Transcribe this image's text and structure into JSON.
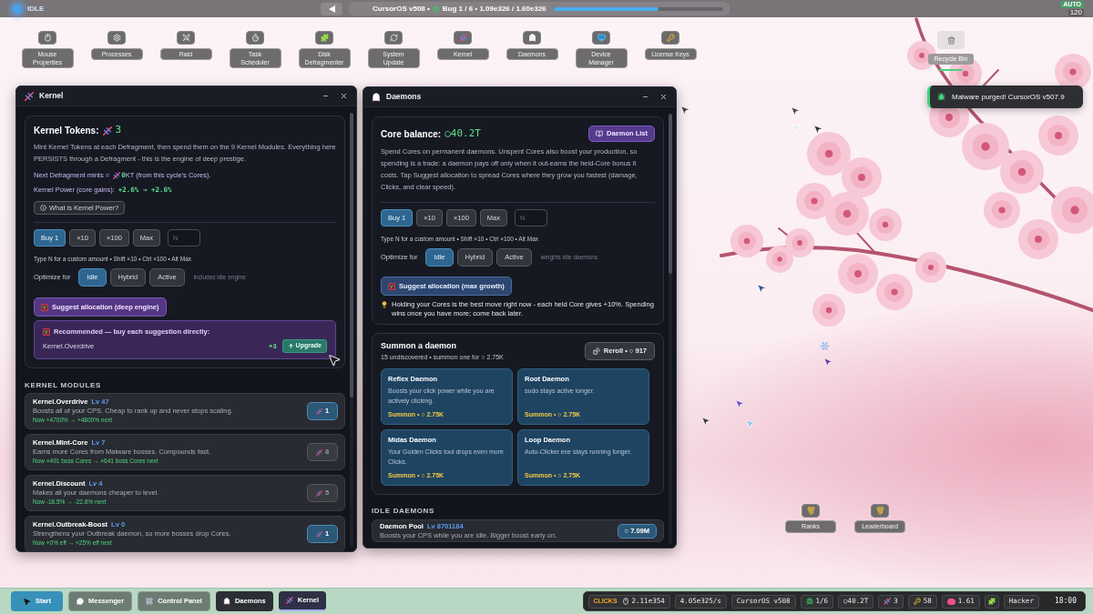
{
  "top_bar": {
    "status": "IDLE",
    "title": "CursorOS v508 •",
    "bug": "Bug 1 / 6 • 1.09e326 / 1.60e326",
    "progress": {
      "level": 0.62
    },
    "auto": {
      "label": "AUTO",
      "count": "120"
    }
  },
  "desktop_icons": [
    {
      "label": "Mouse Properties"
    },
    {
      "label": "Processes"
    },
    {
      "label": "Raid"
    },
    {
      "label": "Task Scheduler"
    },
    {
      "label": "Disk Defragmenter"
    },
    {
      "label": "System Update"
    },
    {
      "label": "Kernel"
    },
    {
      "label": "Daemons"
    },
    {
      "label": "Device Manager"
    },
    {
      "label": "License Keys"
    }
  ],
  "recycle_bin": {
    "label": "Recycle Bin"
  },
  "toast": {
    "message": "Malware purged! CursorOS v507.9"
  },
  "corner_icons": [
    {
      "label": "Ranks"
    },
    {
      "label": "Leaderboard"
    }
  ],
  "kernel_window": {
    "title": "Kernel",
    "tokens": {
      "label": "Kernel Tokens:",
      "value": "3"
    },
    "description": "Mint Kernel Tokens at each Defragment, then spend them on the 9 Kernel Modules. Everything here PERSISTS through a Defragment - this is the engine of deep prestige.",
    "next_mint": {
      "label": "Next Defragment mints =",
      "value": "0",
      "suffix": "KT (from this cycle's Cores)."
    },
    "power": {
      "label": "Kernel Power (core gains):",
      "value": "+2.6% → +2.6%"
    },
    "help_button": "What is Kernel Power?",
    "buy_amounts": [
      {
        "label": "Buy 1",
        "selected": true
      },
      {
        "label": "×10",
        "selected": false
      },
      {
        "label": "×100",
        "selected": false
      },
      {
        "label": "Max",
        "selected": false
      }
    ],
    "amount_field": {
      "placeholder": "N"
    },
    "hint": "Type N for a custom amount • Shift ×10 • Ctrl ×100 • Alt Max",
    "optimize": {
      "label": "Optimize for",
      "options": [
        {
          "label": "Idle",
          "selected": true
        },
        {
          "label": "Hybrid",
          "selected": false
        },
        {
          "label": "Active",
          "selected": false
        }
      ],
      "note": "includes idle engine"
    },
    "suggest_button": "Suggest allocation (deep engine)",
    "recommendation": {
      "title": "Recommended — buy each suggestion directly:",
      "items": [
        {
          "name": "Kernel.Overdrive",
          "amount": "+3",
          "action": "Upgrade"
        }
      ]
    },
    "modules_heading": "KERNEL MODULES",
    "modules": [
      {
        "name": "Kernel.Overdrive",
        "rank": "Lv 47",
        "description": "Boosts all of your CPS. Cheap to rank up and never stops scaling.",
        "effect": "Now +4700% → +4800% next",
        "cost": "1",
        "affordable": true
      },
      {
        "name": "Kernel.Mint-Core",
        "rank": "Lv 7",
        "description": "Earns more Cores from Malware bosses. Compounds fast.",
        "effect": "Now ×491 boss Cores → ×641 boss Cores next",
        "cost": "8",
        "affordable": false
      },
      {
        "name": "Kernel.Discount",
        "rank": "Lv 4",
        "description": "Makes all your daemons cheaper to level.",
        "effect": "Now -18.5% → -22.6% next",
        "cost": "5",
        "affordable": false
      },
      {
        "name": "Kernel.Outbreak-Boost",
        "rank": "Lv 0",
        "description": "Strengthens your Outbreak daemon, so more bosses drop Cores.",
        "effect": "Now +0% eff → +25% eff next",
        "cost": "1",
        "affordable": true
      }
    ]
  },
  "daemons_window": {
    "title": "Daemons",
    "balance": {
      "label": "Core balance:",
      "value": "○40.2T"
    },
    "list_button": "Daemon List",
    "description": "Spend Cores on permanent daemons. Unspent Cores also boost your production, so spending is a trade: a daemon pays off only when it out-earns the held-Core bonus it costs. Tap Suggest allocation to spread Cores where they grow you fastest (damage, Clicks, and clear speed).",
    "buy_amounts": [
      {
        "label": "Buy 1",
        "selected": true
      },
      {
        "label": "×10",
        "selected": false
      },
      {
        "label": "×100",
        "selected": false
      },
      {
        "label": "Max",
        "selected": false
      }
    ],
    "amount_field": {
      "placeholder": "N"
    },
    "hint": "Type N for a custom amount • Shift ×10 • Ctrl ×100 • Alt Max",
    "optimize": {
      "label": "Optimize for",
      "options": [
        {
          "label": "Idle",
          "selected": true
        },
        {
          "label": "Hybrid",
          "selected": false
        },
        {
          "label": "Active",
          "selected": false
        }
      ],
      "note": "weights idle daemons"
    },
    "suggest_button": "Suggest allocation (max growth)",
    "tip": "Holding your Cores is the best move right now - each held Core gives +10%. Spending wins once you have more; come back later.",
    "summon": {
      "title": "Summon a daemon",
      "subtitle": "15 undiscovered • summon one for ○ 2.75K",
      "reroll_button": "Reroll • ○ 917",
      "candidates": [
        {
          "name": "Reflex Daemon",
          "description": "Boosts your click power while you are actively clicking.",
          "action": "Summon • ○ 2.75K"
        },
        {
          "name": "Root Daemon",
          "description": "sudo stays active longer.",
          "action": "Summon • ○ 2.75K"
        },
        {
          "name": "Midas Daemon",
          "description": "Your Golden Clicks tool drops even more Clicks.",
          "action": "Summon • ○ 2.75K"
        },
        {
          "name": "Loop Daemon",
          "description": "Auto-Clicker.exe stays running longer.",
          "action": "Summon • ○ 2.75K"
        }
      ]
    },
    "idle_heading": "IDLE DAEMONS",
    "idle_daemons": [
      {
        "name": "Daemon Pool",
        "rank": "Lv 8701184",
        "description": "Boosts your CPS while you are idle. Bigger boost early on.",
        "cost": "○ 7.09M",
        "affordable": true
      }
    ]
  },
  "taskbar": {
    "start": "Start",
    "apps": [
      {
        "label": "Messenger",
        "open": false,
        "selected": false
      },
      {
        "label": "Control Panel",
        "open": false,
        "selected": false
      },
      {
        "label": "Daemons",
        "open": true,
        "selected": false
      },
      {
        "label": "Kernel",
        "open": true,
        "selected": true
      }
    ],
    "tray": {
      "clicks_label": "CLICKS",
      "clicks": "2.11e354",
      "rate": "4.05e325/s",
      "version": "CursorOS v508",
      "bugs": "1/6",
      "cores": "○40.2T",
      "tokens": "3",
      "keys": "58",
      "multiplier": "1.61",
      "rank": "Hacker",
      "clock": "18:00"
    }
  }
}
